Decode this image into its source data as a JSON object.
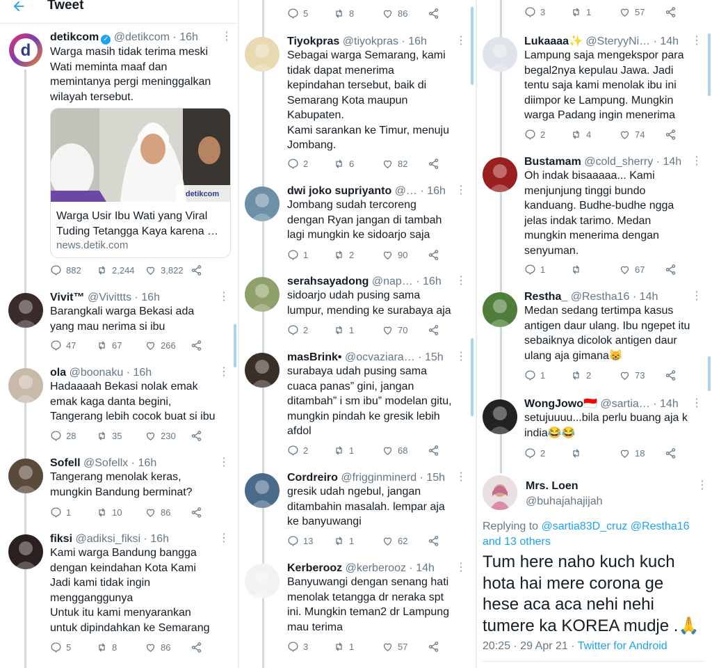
{
  "header": {
    "title": "Tweet"
  },
  "main_tweet": {
    "name": "detikcom",
    "handle": "@detikcom",
    "time": "16h",
    "text": "Warga masih tidak terima meski\nWati meminta maaf dan\nmemintanya pergi meninggalkan\nwilayah tersebut.",
    "card": {
      "brand": "detikcom",
      "title": "Warga Usir Ibu Wati yang Viral\nTuding Tetangga Kaya karena …",
      "domain": "news.detik.com"
    },
    "replies": "882",
    "retweets": "2,244",
    "likes": "3,822"
  },
  "col1_replies": [
    {
      "name": "Vivit™",
      "handle": "@Vivittts",
      "time": "16h",
      "text": "Barangkali warga Bekasi ada\nyang mau nerima si ibu",
      "replies": "47",
      "retweets": "67",
      "likes": "266"
    },
    {
      "name": "ola",
      "handle": "@boonaku",
      "time": "16h",
      "text": "Hadaaaah Bekasi nolak emak\nemak kaga danta begini,\nTangerang lebih cocok buat si ibu",
      "replies": "28",
      "retweets": "35",
      "likes": "230"
    },
    {
      "name": "Sofell",
      "handle": "@Sofellx",
      "time": "16h",
      "text": "Tangerang menolak keras,\nmungkin Bandung berminat?",
      "replies": "1",
      "retweets": "10",
      "likes": "86"
    },
    {
      "name": "fiksi",
      "handle": "@adiksi_fiksi",
      "time": "16h",
      "text": "Kami warga Bandung bangga\ndengan keindahan Kota Kami\nJadi kami tidak ingin\nmengganggunya\nUntuk itu kami menyarankan\nuntuk dipindahkan ke Semarang",
      "replies": "5",
      "retweets": "8",
      "likes": "86"
    }
  ],
  "col2_top_actions": {
    "replies": "5",
    "retweets": "8",
    "likes": "86"
  },
  "col2_replies": [
    {
      "name": "Tiyokpras",
      "handle": "@tiyokpras",
      "time": "16h",
      "text": "Sebagai warga Semarang, kami\ntidak dapat menerima\nkepindahan tersebut, baik di\nSemarang Kota maupun\nKabupaten.\nKami sarankan ke Timur, menuju\nJombang.",
      "replies": "2",
      "retweets": "6",
      "likes": "82"
    },
    {
      "name": "dwi joko supriyanto",
      "handle": "@…",
      "time": "16h",
      "text": "Jombang sudah tercoreng\ndengan Ryan jangan di tambah\nlagi mungkin ke sidoarjo saja",
      "replies": "1",
      "retweets": "2",
      "likes": "90"
    },
    {
      "name": "serahsayadong",
      "handle": "@nap…",
      "time": "16h",
      "text": "sidoarjo udah pusing sama\nlumpur, mending ke surabaya aja",
      "replies": "2",
      "retweets": "1",
      "likes": "70"
    },
    {
      "name": "masBrink•",
      "handle": "@ocvaziara…",
      "time": "15h",
      "text": "surabaya udah pusing sama\ncuaca panas” gini, jangan\nditambah” i sm ibu” modelan gitu,\nmungkin pindah ke gresik lebih\nafdol",
      "replies": "2",
      "retweets": "1",
      "likes": "68"
    },
    {
      "name": "Cordreiro",
      "handle": "@frigginminerd",
      "time": "15h",
      "text": "gresik udah ngebul, jangan\nditambahin masalah. lempar aja\nke banyuwangi",
      "replies": "13",
      "retweets": "1",
      "likes": "62"
    },
    {
      "name": "Kerberooz",
      "handle": "@kerberooz",
      "time": "14h",
      "text": "Banyuwangi dengan senang hati\nmenolak tetangga dr neraka spt\nini. Mungkin teman2 dr Lampung\nmau terima",
      "replies": "3",
      "retweets": "1",
      "likes": "57"
    }
  ],
  "col3_top_actions": {
    "replies": "3",
    "retweets": "1",
    "likes": "57"
  },
  "col3_replies": [
    {
      "name": "Lukaaaa✨",
      "handle": "@SteryyNi…",
      "time": "14h",
      "text": "Lampung saja mengekspor para\nbegal2nya kepulau Jawa. Jadi\ntentu saja kami menolak ibu ini\ndiimpor ke Lampung. Mungkin\nwarga Padang ingin menerima",
      "replies": "2",
      "retweets": "4",
      "likes": "74"
    },
    {
      "name": "Bustamam",
      "handle": "@cold_sherry",
      "time": "14h",
      "text": "Oh indak bisaaaaa... Kami\nmenjunjung tinggi bundo\nkanduang. Budhe-budhe ngga\njelas indak tarimo. Medan\nmungkin menerima dengan\nsenyuman.",
      "replies": "1",
      "retweets": "",
      "likes": "67"
    },
    {
      "name": "Restha_",
      "handle": "@Restha16",
      "time": "14h",
      "text": "Medan sedang tertimpa kasus\nantigen daur ulang. Ibu ngepet itu\nsebaiknya dicolok antigen daur\nulang aja gimana😸",
      "replies": "1",
      "retweets": "2",
      "likes": "73"
    },
    {
      "name": "WongJowo🇮🇩",
      "handle": "@sartia…",
      "time": "14h",
      "text": "setujuuuu...bila perlu buang aja k\nindia😂😂",
      "replies": "2",
      "retweets": "",
      "likes": "18"
    }
  ],
  "final_tweet": {
    "name": "Mrs. Loen",
    "handle": "@buhajahajijah",
    "replying_prefix": "Replying to",
    "replying_users": "@sartia83D_cruz @Restha16",
    "replying_more": "and 13 others",
    "text": "Tum here naho kuch kuch\nhota hai mere corona ge\nhese aca aca nehi nehi\ntumere ka KOREA mudje .🙏",
    "time": "20:25",
    "date": "29 Apr 21",
    "source": "Twitter for Android"
  },
  "colors": {
    "accent": "#1da1f2",
    "text": "#141d26",
    "muted": "#657786",
    "thread": "#cfd9de"
  }
}
